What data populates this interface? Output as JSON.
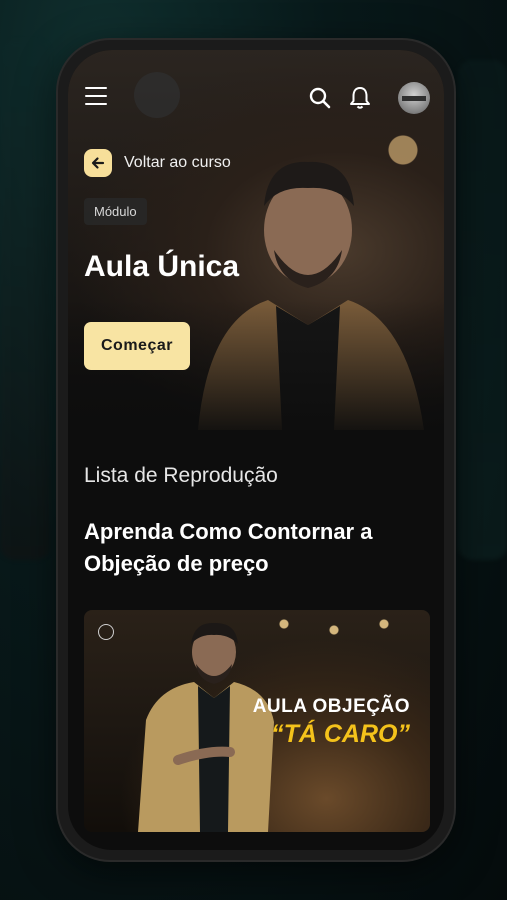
{
  "nav": {
    "menu_icon": "menu-icon",
    "search_icon": "search-icon",
    "bell_icon": "bell-icon",
    "avatar": "user-avatar"
  },
  "back": {
    "label": "Voltar ao curso",
    "icon": "arrow-left-icon"
  },
  "module": {
    "badge": "Módulo",
    "title": "Aula Única",
    "start_label": "Começar"
  },
  "playlist": {
    "heading": "Lista de Reprodução",
    "lesson_title": "Aprenda Como Contornar a Objeção de preço",
    "thumbnail": {
      "line1": "AULA OBJEÇÃO",
      "line2": "“TÁ CARO”"
    }
  },
  "colors": {
    "accent": "#f8e4a3",
    "thumb_highlight": "#f4c21b",
    "screen_bg": "#0d0d0d"
  }
}
